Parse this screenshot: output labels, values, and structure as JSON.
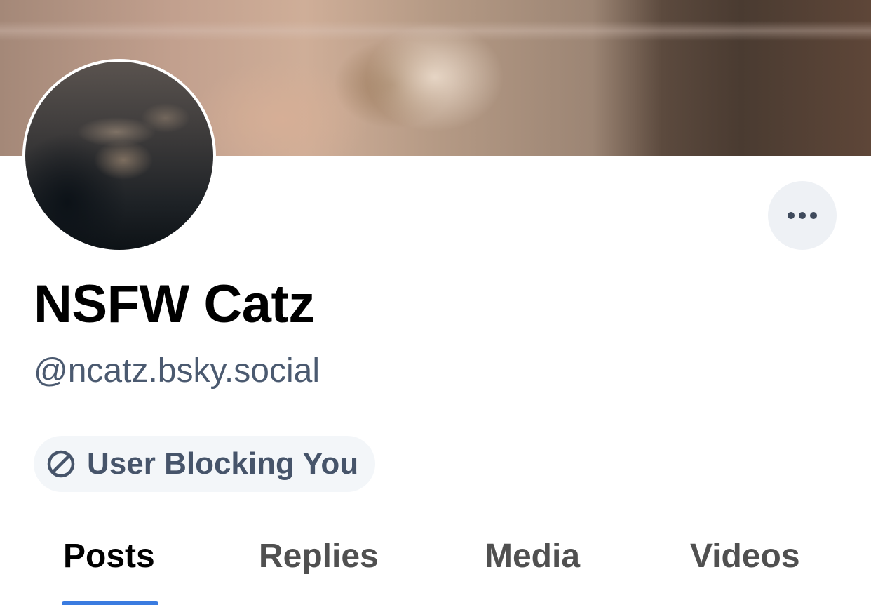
{
  "profile": {
    "display_name": "NSFW Catz",
    "handle": "@ncatz.bsky.social",
    "banner_icon": "banner-image",
    "avatar_icon": "avatar-image"
  },
  "actions": {
    "more_icon": "ellipsis-icon"
  },
  "status": {
    "badge_label": "User Blocking You",
    "badge_icon": "block-icon"
  },
  "tabs": [
    {
      "label": "Posts",
      "active": true
    },
    {
      "label": "Replies",
      "active": false
    },
    {
      "label": "Media",
      "active": false
    },
    {
      "label": "Videos",
      "active": false
    }
  ],
  "colors": {
    "accent": "#3a7be0",
    "badge_bg": "#f3f6f9",
    "muted_text": "#4b5a70",
    "more_button_bg": "#eef1f5"
  }
}
